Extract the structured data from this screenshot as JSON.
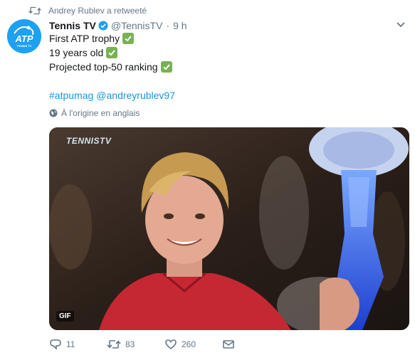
{
  "retweet": {
    "text": "Andrey Rublev a retweeté",
    "icon": "retweet-icon"
  },
  "author": {
    "name": "Tennis TV",
    "handle": "@TennisTV",
    "time": "9 h",
    "dot": "·",
    "avatar": {
      "logo": "ATP",
      "subtext": "TENNIS TV",
      "color": "#1da1f2"
    }
  },
  "tweet": {
    "lines": [
      "First ATP trophy",
      "19 years old",
      "Projected top-50 ranking"
    ],
    "hashtags": [
      "#atpumag",
      "@andreyrublev97"
    ],
    "translate": "À l'origine en anglais"
  },
  "media": {
    "badge": "GIF",
    "overlay_logo": "TENNISTV"
  },
  "actions": {
    "replies": "11",
    "retweets": "83",
    "likes": "260"
  },
  "colors": {
    "accent": "#1b95e0",
    "muted": "#657786",
    "check_green": "#77b255"
  }
}
